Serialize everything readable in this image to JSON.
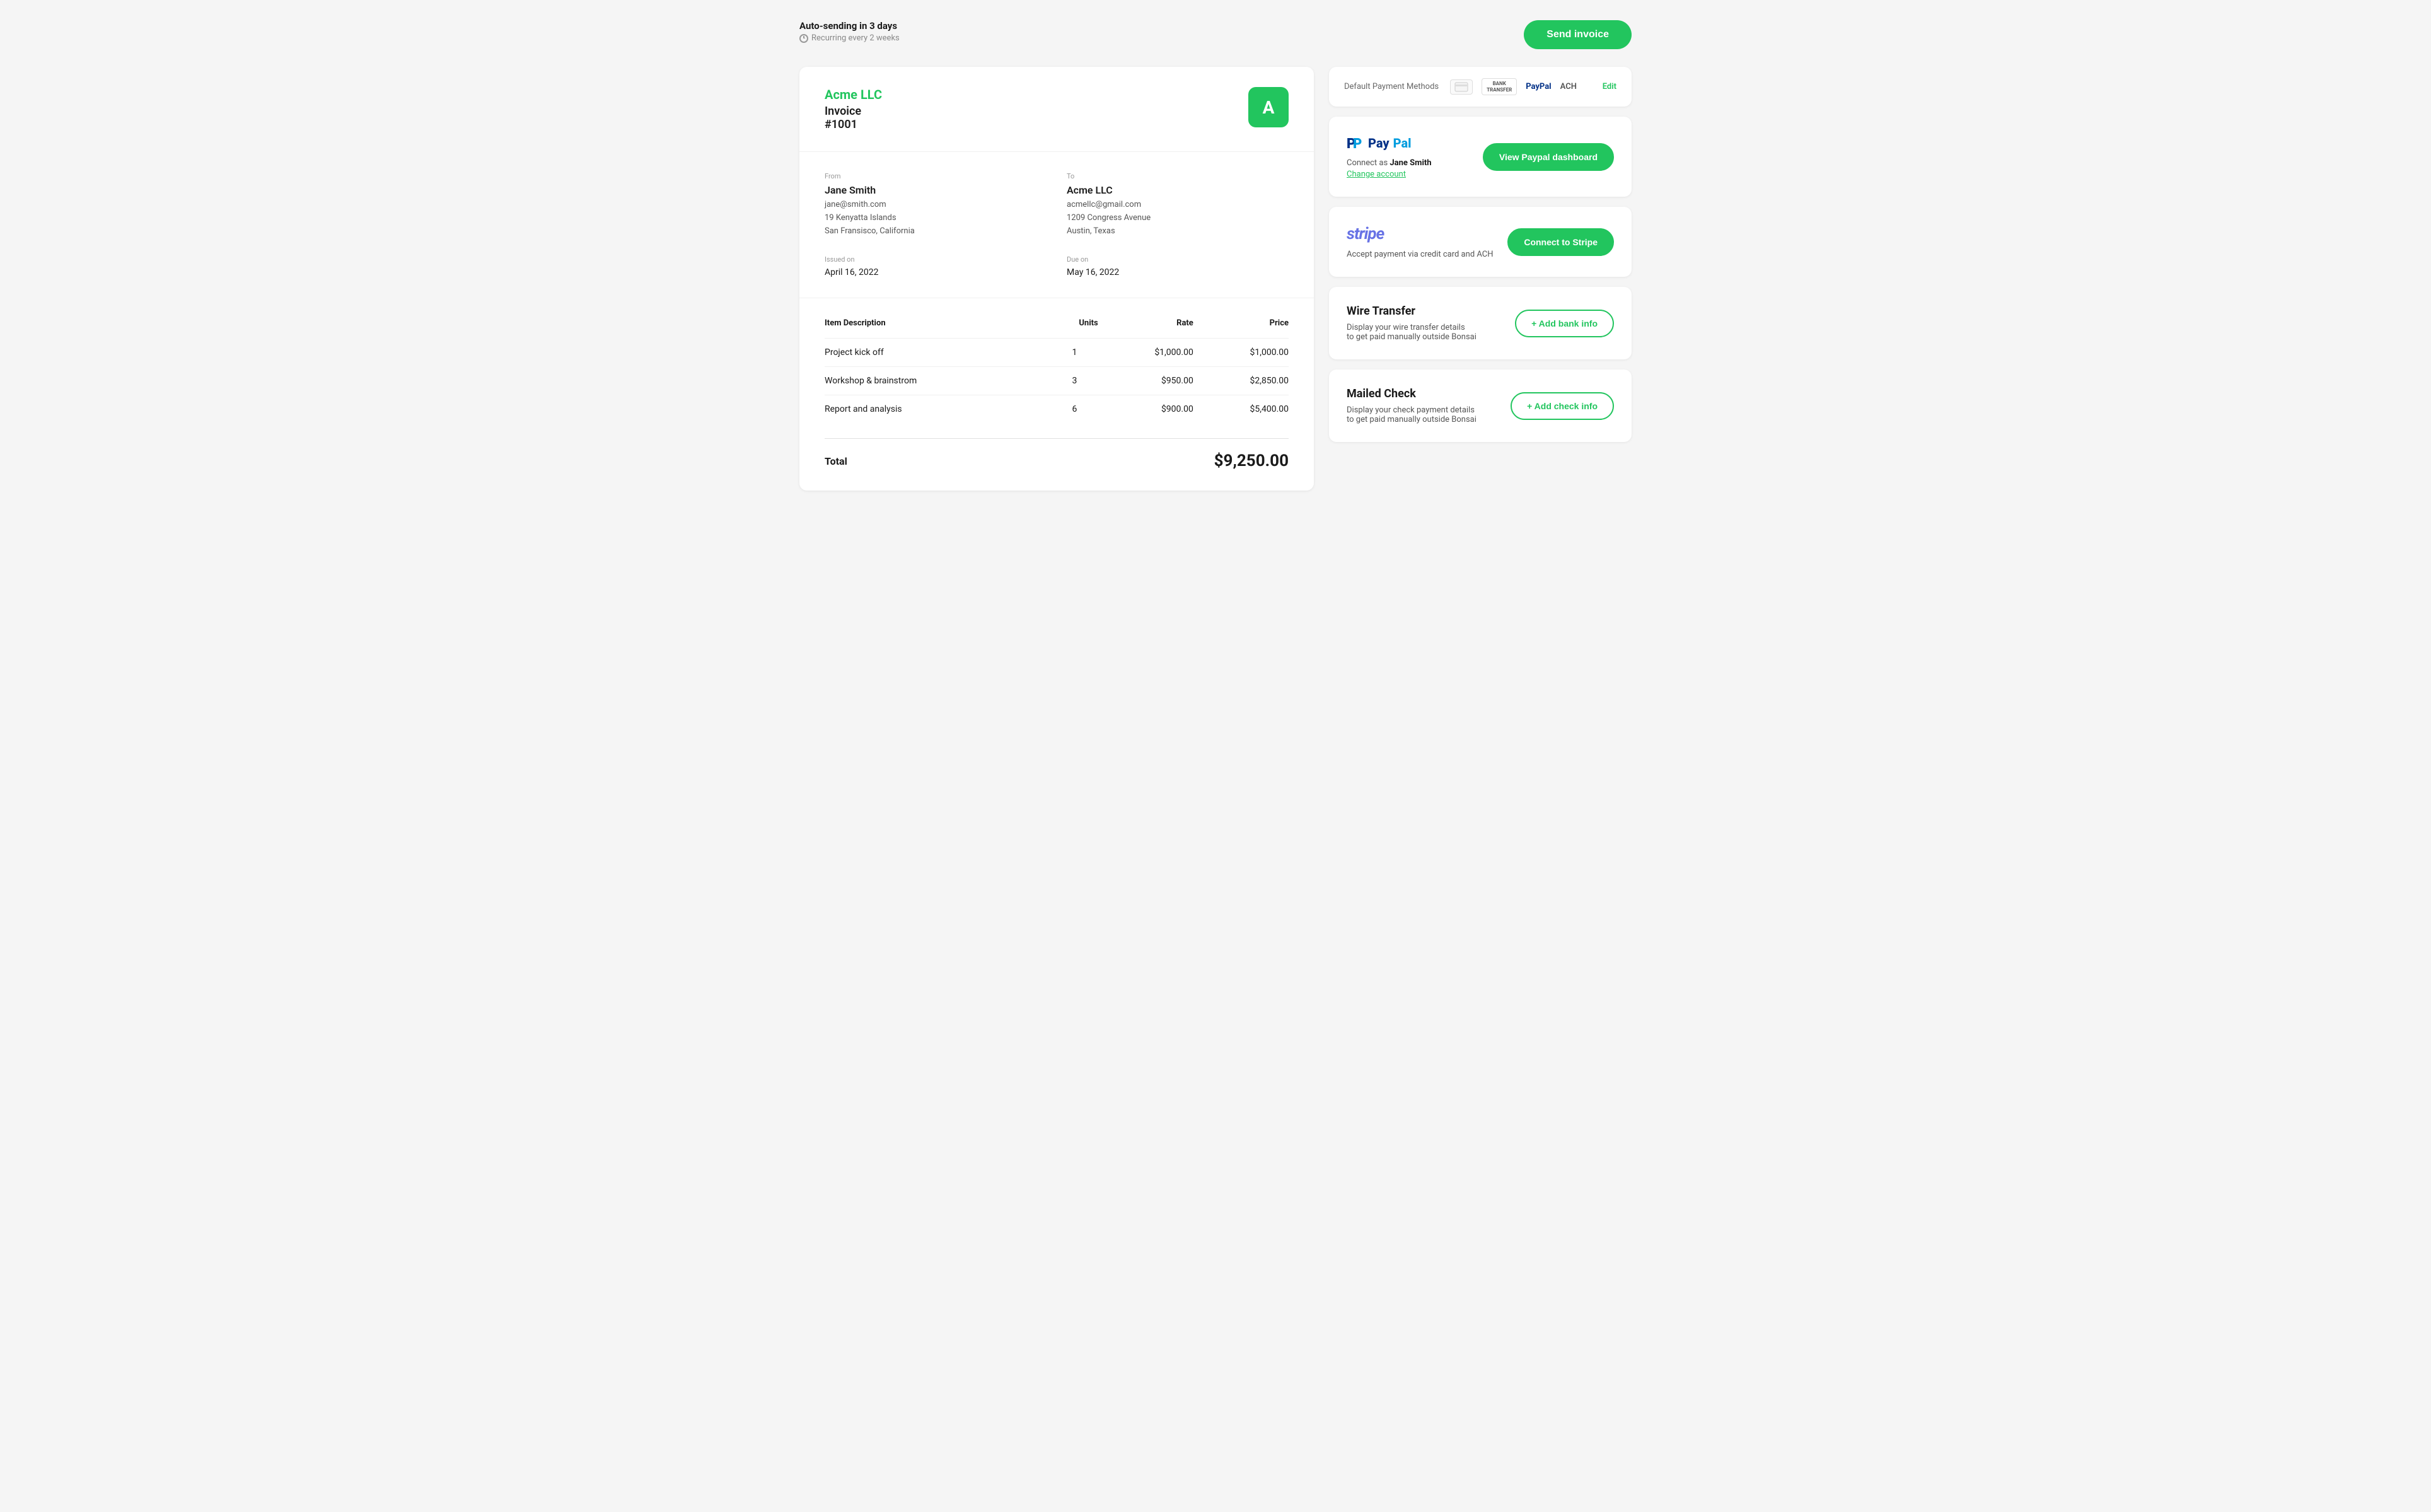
{
  "header": {
    "auto_send_title": "Auto-sending in 3 days",
    "auto_send_subtitle": "Recurring every 2 weeks",
    "send_invoice_label": "Send invoice"
  },
  "invoice": {
    "company": "Acme LLC",
    "invoice_label": "Invoice",
    "invoice_number": "#1001",
    "avatar_letter": "A",
    "from": {
      "label": "From",
      "name": "Jane Smith",
      "email": "jane@smith.com",
      "address_line1": "19 Kenyatta Islands",
      "address_line2": "San Fransisco, California"
    },
    "to": {
      "label": "To",
      "name": "Acme LLC",
      "email": "acmellc@gmail.com",
      "address_line1": "1209 Congress Avenue",
      "address_line2": "Austin, Texas"
    },
    "issued": {
      "label": "Issued on",
      "value": "April 16, 2022"
    },
    "due": {
      "label": "Due on",
      "value": "May 16, 2022"
    },
    "columns": {
      "description": "Item Description",
      "units": "Units",
      "rate": "Rate",
      "price": "Price"
    },
    "items": [
      {
        "description": "Project kick off",
        "units": "1",
        "rate": "$1,000.00",
        "price": "$1,000.00"
      },
      {
        "description": "Workshop & brainstrom",
        "units": "3",
        "rate": "$950.00",
        "price": "$2,850.00"
      },
      {
        "description": "Report and analysis",
        "units": "6",
        "rate": "$900.00",
        "price": "$5,400.00"
      }
    ],
    "total_label": "Total",
    "total_amount": "$9,250.00"
  },
  "payment": {
    "default_methods_label": "Default Payment Methods",
    "bank_transfer_badge": "BANK\nTRANSFER",
    "paypal_text": "PayPal",
    "ach_text": "ACH",
    "edit_label": "Edit",
    "paypal_card": {
      "connect_as_prefix": "Connect as ",
      "connect_as_name": "Jane Smith",
      "change_account": "Change account",
      "button_label": "View Paypal dashboard"
    },
    "stripe_card": {
      "logo_text": "stripe",
      "description": "Accept payment via credit card and ACH",
      "button_label": "Connect to Stripe"
    },
    "wire_card": {
      "title": "Wire Transfer",
      "desc_line1": "Display your wire transfer details",
      "desc_line2": "to get paid manually outside Bonsai",
      "button_label": "+ Add bank info"
    },
    "check_card": {
      "title": "Mailed Check",
      "desc_line1": "Display your check payment details",
      "desc_line2": "to get paid manually outside Bonsai",
      "button_label": "+ Add check info"
    }
  }
}
